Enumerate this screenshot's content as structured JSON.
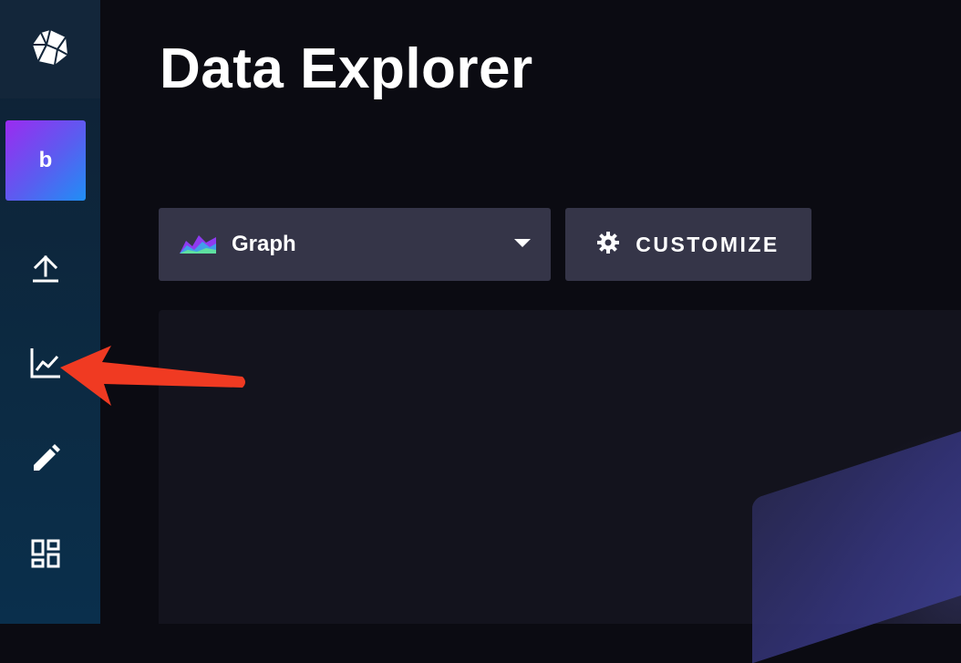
{
  "sidebar": {
    "logo_icon": "influx-cube-logo-icon",
    "org_initial": "b",
    "items": [
      {
        "name": "load-data",
        "icon": "upload-icon"
      },
      {
        "name": "data-explorer",
        "icon": "line-chart-icon"
      },
      {
        "name": "notebooks",
        "icon": "pencil-icon"
      },
      {
        "name": "dashboards",
        "icon": "dashboard-grid-icon"
      }
    ]
  },
  "header": {
    "title": "Data Explorer"
  },
  "toolbar": {
    "vis_type_label": "Graph",
    "vis_type_icon": "graph-vis-icon",
    "customize_label": "CUSTOMIZE",
    "customize_icon": "gear-icon"
  },
  "annotation": {
    "arrow_color": "#f03a22",
    "arrow_icon": "red-pointer-arrow"
  },
  "colors": {
    "background": "#0b0b12",
    "sidebar": "#0c2a42",
    "button": "#353548",
    "accent_gradient_start": "#9b2bf0",
    "accent_gradient_end": "#1f8ff5"
  }
}
